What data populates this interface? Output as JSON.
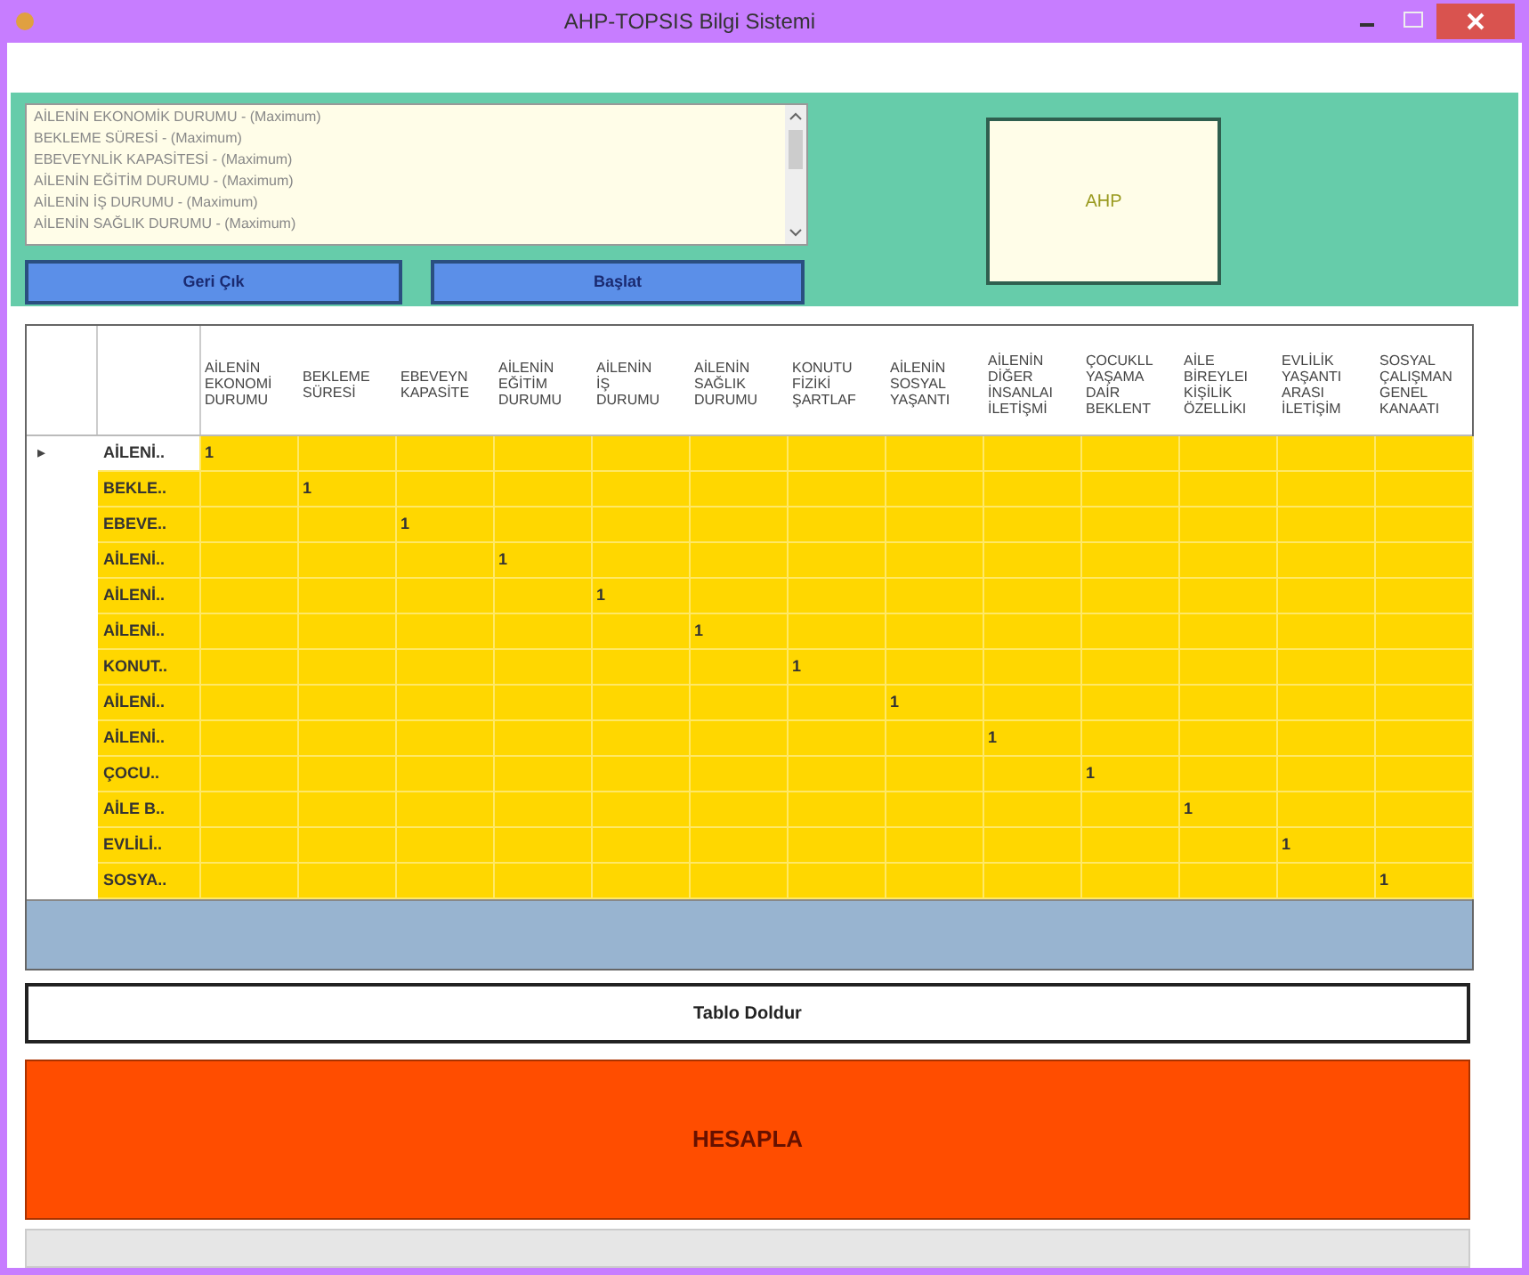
{
  "window": {
    "title": "AHP-TOPSIS Bilgi Sistemi"
  },
  "criteria_list": [
    "AİLENİN EKONOMİK DURUMU - (Maximum)",
    "BEKLEME SÜRESİ - (Maximum)",
    "EBEVEYNLİK KAPASİTESİ - (Maximum)",
    "AİLENİN EĞİTİM DURUMU - (Maximum)",
    "AİLENİN İŞ DURUMU - (Maximum)",
    "AİLENİN SAĞLIK DURUMU - (Maximum)"
  ],
  "buttons": {
    "back": "Geri Çık",
    "start": "Başlat",
    "fill_table": "Tablo Doldur",
    "calculate": "HESAPLA"
  },
  "ahp_label": "AHP",
  "progress": {
    "level": 0
  },
  "table": {
    "columns": [
      "AİLENİN\nEKONOMİ\nDURUMU",
      "BEKLEME\nSÜRESİ",
      "EBEVEYN\nKAPASİTE",
      "AİLENİN\nEĞİTİM\nDURUMU",
      "AİLENİN\nİŞ\nDURUMU",
      "AİLENİN\nSAĞLIK\nDURUMU",
      "KONUTU\nFİZİKİ\nŞARTLAF",
      "AİLENİN\nSOSYAL\nYAŞANTI",
      "AİLENİN\nDİĞER\nİNSANLAI\nİLETİŞMİ",
      "ÇOCUKLL\nYAŞAMA\nDAİR\nBEKLENT",
      "AİLE\nBİREYLEI\nKİŞİLİK\nÖZELLİKI",
      "EVLİLİK\nYAŞANTI\nARASI\nİLETİŞİM",
      "SOSYAL\nÇALIŞMAN\nGENEL\nKANAATI"
    ],
    "current_marker": "▸",
    "rows": [
      {
        "label": "AİLENİ..",
        "value": "1",
        "selected": true
      },
      {
        "label": "BEKLE..",
        "value": "1",
        "selected": false
      },
      {
        "label": "EBEVE..",
        "value": "1",
        "selected": false
      },
      {
        "label": "AİLENİ..",
        "value": "1",
        "selected": false
      },
      {
        "label": "AİLENİ..",
        "value": "1",
        "selected": false
      },
      {
        "label": "AİLENİ..",
        "value": "1",
        "selected": false
      },
      {
        "label": "KONUT..",
        "value": "1",
        "selected": false
      },
      {
        "label": "AİLENİ..",
        "value": "1",
        "selected": false
      },
      {
        "label": "AİLENİ..",
        "value": "1",
        "selected": false
      },
      {
        "label": "ÇOCU..",
        "value": "1",
        "selected": false
      },
      {
        "label": "AİLE B..",
        "value": "1",
        "selected": false
      },
      {
        "label": "EVLİLİ..",
        "value": "1",
        "selected": false
      },
      {
        "label": "SOSYA..",
        "value": "1",
        "selected": false
      }
    ]
  }
}
